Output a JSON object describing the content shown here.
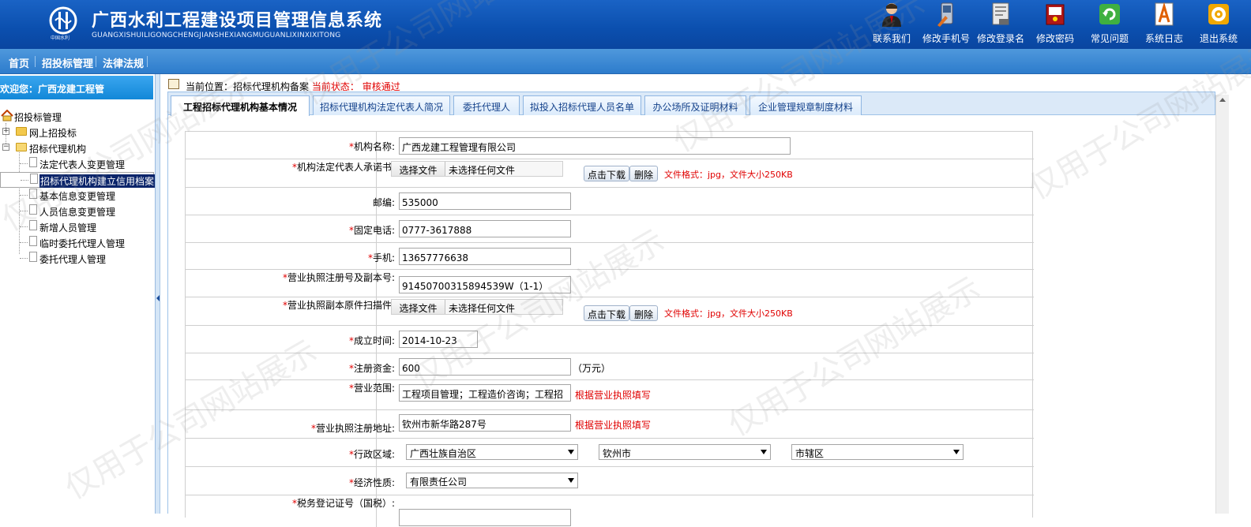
{
  "header": {
    "title": "广西水利工程建设项目管理信息系统",
    "pinyin": "GUANGXISHUILIGONGCHENGJIANSHEXIANGMUGUANLIXINXIXITONG",
    "logo_sub": "中国水利",
    "buttons": [
      {
        "label": "联系我们",
        "icon": "contact-person-icon"
      },
      {
        "label": "修改手机号",
        "icon": "phone-edit-icon"
      },
      {
        "label": "修改登录名",
        "icon": "document-edit-icon"
      },
      {
        "label": "修改密码",
        "icon": "password-book-icon"
      },
      {
        "label": "常见问题",
        "icon": "refresh-question-icon"
      },
      {
        "label": "系统日志",
        "icon": "log-document-icon"
      },
      {
        "label": "退出系统",
        "icon": "gear-exit-icon"
      }
    ]
  },
  "nav": {
    "items": [
      "首页",
      "招投标管理",
      "法律法规"
    ]
  },
  "sidebar": {
    "welcome": "欢迎您：广西龙建工程管",
    "tree": {
      "root": "招投标管理",
      "online": "网上招投标",
      "agency": "招标代理机构",
      "children": [
        "法定代表人变更管理",
        "招标代理机构建立信用档案",
        "基本信息变更管理",
        "人员信息变更管理",
        "新增人员管理",
        "临时委托代理人管理",
        "委托代理人管理"
      ]
    }
  },
  "breadcrumb": {
    "prefix": "当前位置：招标代理机构备案",
    "status_label": "当前状态：",
    "status_value": "审核通过"
  },
  "tabs": [
    "工程招标代理机构基本情况",
    "招标代理机构法定代表人简况",
    "委托代理人",
    "拟投入招标代理人员名单",
    "办公场所及证明材料",
    "企业管理规章制度材料"
  ],
  "form": {
    "org_name": {
      "label": "机构名称:",
      "value": "广西龙建工程管理有限公司"
    },
    "rep_letter": {
      "label": "机构法定代表人承诺书:",
      "file_btn": "选择文件",
      "file_text": "未选择任何文件",
      "download": "点击下载",
      "delete": "删除",
      "note": "文件格式：jpg，文件大小250KB"
    },
    "postcode": {
      "label": "邮编:",
      "value": "535000"
    },
    "phone": {
      "label": "固定电话:",
      "value": "0777-3617888"
    },
    "mobile": {
      "label": "手机:",
      "value": "13657776638"
    },
    "license_no": {
      "label": "营业执照注册号及副本号:",
      "value": "91450700315894539W（1-1）"
    },
    "license_scan": {
      "label": "营业执照副本原件扫描件:",
      "file_btn": "选择文件",
      "file_text": "未选择任何文件",
      "download": "点击下载",
      "delete": "删除",
      "note": "文件格式：jpg，文件大小250KB"
    },
    "founded": {
      "label": "成立时间:",
      "value": "2014-10-23"
    },
    "capital": {
      "label": "注册资金:",
      "value": "600",
      "unit": "（万元）"
    },
    "scope": {
      "label": "营业范围:",
      "value": "工程项目管理；工程造价咨询；工程招",
      "note": "根据营业执照填写"
    },
    "address": {
      "label": "营业执照注册地址:",
      "value": "钦州市新华路287号",
      "note": "根据营业执照填写"
    },
    "region": {
      "label": "行政区域:",
      "province": "广西壮族自治区",
      "city": "钦州市",
      "district": "市辖区"
    },
    "econ_type": {
      "label": "经济性质:",
      "value": "有限责任公司"
    },
    "tax_no": {
      "label": "税务登记证号（国税）:"
    }
  },
  "watermark": "仅用于公司网站展示"
}
